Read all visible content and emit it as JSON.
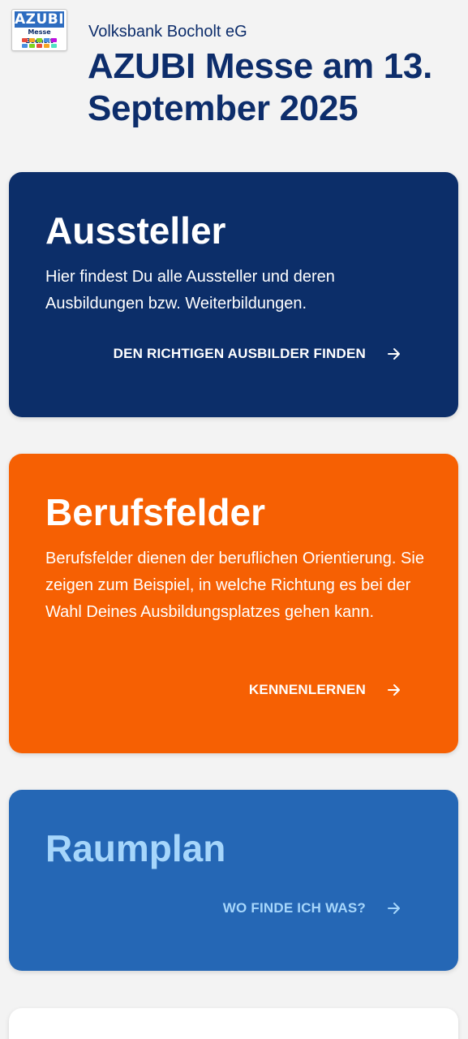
{
  "header": {
    "logo": {
      "line1": "AZUBI",
      "line2": "Messe Bocholt"
    },
    "bank_name": "Volksbank Bocholt eG",
    "title": "AZUBI Messe am 13. September 2025"
  },
  "cards": [
    {
      "title": "Aussteller",
      "text": "Hier findest Du alle Aussteller und deren Ausbildungen bzw. Weiterbildungen.",
      "link_label": "DEN RICHTIGEN AUSBILDER FINDEN",
      "icon": "arrow-right-icon",
      "color": "#0c2e69"
    },
    {
      "title": "Berufsfelder",
      "text": "Berufsfelder dienen der beruflichen Orientierung. Sie zeigen zum Beispiel, in welche Richtung es bei der Wahl Deines Ausbildungsplatzes gehen kann.",
      "link_label": "KENNENLERNEN",
      "icon": "arrow-right-icon",
      "color": "#f66003"
    },
    {
      "title": "Raumplan",
      "link_label": "WO FINDE ICH WAS?",
      "icon": "arrow-right-icon",
      "color": "#2567b5",
      "accent": "#a6d6fb"
    }
  ]
}
